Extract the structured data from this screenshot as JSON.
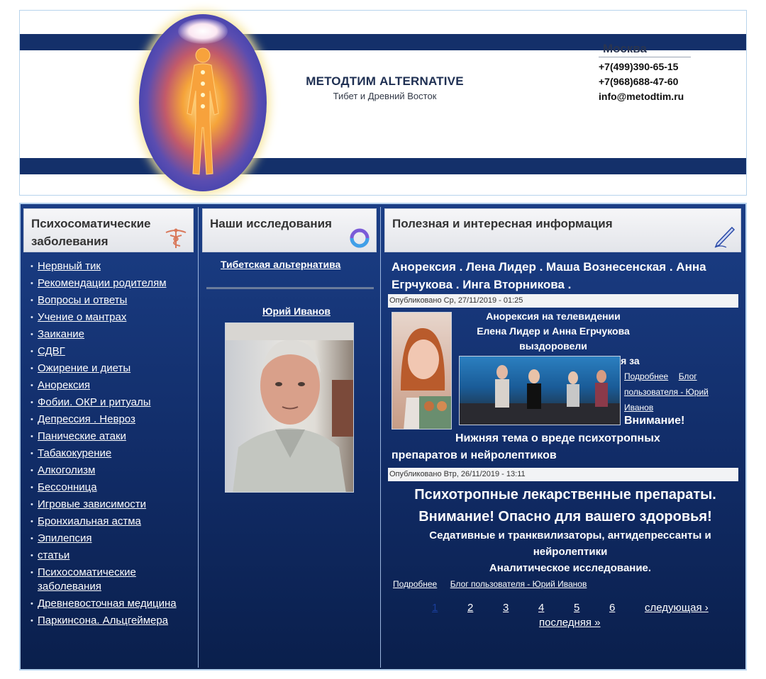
{
  "header": {
    "brand_title": "МЕТОДТИМ ALTERNATIVE",
    "brand_subtitle": "Тибет и Древний Восток",
    "city": "Москва",
    "phone1": "+7(499)390-65-15",
    "phone2": "+7(968)688-47-60",
    "email": "info@metodtim.ru"
  },
  "left": {
    "title_line1": "Психосоматические",
    "title_line2": "заболевания",
    "items": [
      "Нервный тик",
      "Рекомендации родителям",
      "Вопросы и ответы",
      "Учение о мантрах",
      "Заикание",
      "СДВГ",
      "Ожирение и диеты",
      "Анорексия",
      "Фобии. ОКР и ритуалы",
      "Депрессия . Невроз",
      "Панические атаки",
      "Табакокурение",
      "Алкоголизм",
      "Бессонница",
      "Игровые зависимости",
      "Бронхиальная астма",
      "Эпилепсия",
      "статьи",
      "Психосоматические заболевания",
      "Древневосточная медицина",
      "Паркинсона. Альцгеймера"
    ]
  },
  "middle": {
    "title": "Наши исследования",
    "link1": "Тибетская альтернатива",
    "author": "Юрий Иванов"
  },
  "right": {
    "title": "Полезная и интересная информация",
    "article1": {
      "title_line1": "Анорексия . Лена Лидер . Маша Вознесенская . Анна",
      "title_line2": "Егрчукова . Инга Вторникова .",
      "meta": "Опубликовано Ср, 27/11/2019 - 01:25",
      "line1": "Анорексия  на  телевидении",
      "line2": "Елена Лидер и Анна Егрчукова выздоровели",
      "line3": "Раскрываем тайны, оставшиеся за кадром",
      "more": "Подробнее",
      "blog_line1": "Блог",
      "blog_line2": "пользователя - Юрий",
      "blog_line3": "Иванов",
      "attention": "Внимание!",
      "tail_line1": "Нижняя тема о вреде психотропных",
      "tail_line2": "препаратов и нейролептиков"
    },
    "article2": {
      "meta": "Опубликовано Втр, 26/11/2019 - 13:11",
      "big1": "Психотропные лекарственные препараты.",
      "big2": "Внимание! Опасно для вашего здоровья!",
      "mid1": "Седативные и транквилизаторы, антидепрессанты и",
      "mid2": "нейролептики",
      "mid3": "Аналитическое исследование.",
      "more": "Подробнее",
      "blog": "Блог пользователя - Юрий Иванов"
    },
    "pager": {
      "current": "1",
      "p2": "2",
      "p3": "3",
      "p4": "4",
      "p5": "5",
      "p6": "6",
      "next": "следующая ›",
      "last": "последняя »"
    }
  },
  "colors": {
    "navy": "#14306a",
    "panel_blue": "#112c67",
    "link_white": "#ffffff",
    "pager_current": "#1a3e9c"
  }
}
